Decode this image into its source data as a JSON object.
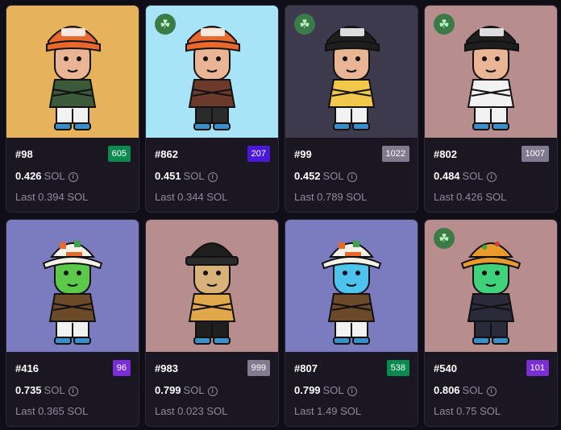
{
  "colors": {
    "rank_green": "#0a8a4e",
    "rank_indigo": "#4a18d9",
    "rank_grey": "#807b8f",
    "rank_purple": "#7a2ed6"
  },
  "cards": [
    {
      "token": "#98",
      "rank": "605",
      "rank_color": "#0a8a4e",
      "price": "0.426",
      "unit": "SOL",
      "last": "Last 0.394 SOL",
      "bg": "#e6b35a",
      "clover": false,
      "hat": "cap-orange",
      "skin": "#e9b594",
      "shirt": "#3a5a3a",
      "pants": "#f2f2f2",
      "hat_text": "PUDGY LAND"
    },
    {
      "token": "#862",
      "rank": "207",
      "rank_color": "#4a18d9",
      "price": "0.451",
      "unit": "SOL",
      "last": "Last 0.344 SOL",
      "bg": "#a7e4f8",
      "clover": true,
      "clover_icon": "☘",
      "hat": "cap-orange",
      "skin": "#e9b594",
      "shirt": "#6b3a2a",
      "pants": "#2a2a2a",
      "hat_text": "PUDGY LAND"
    },
    {
      "token": "#99",
      "rank": "1022",
      "rank_color": "#807b8f",
      "price": "0.452",
      "unit": "SOL",
      "last": "Last 0.789 SOL",
      "bg": "#3c3a4c",
      "clover": true,
      "clover_icon": "☘",
      "hat": "cap-black",
      "skin": "#e9b594",
      "shirt": "#f1c84b",
      "pants": "#f2f2f2",
      "hat_text": "PUDGY LAND"
    },
    {
      "token": "#802",
      "rank": "1007",
      "rank_color": "#807b8f",
      "price": "0.484",
      "unit": "SOL",
      "last": "Last 0.426 SOL",
      "bg": "#b78d8e",
      "clover": true,
      "clover_icon": "☘",
      "hat": "cap-black",
      "skin": "#e9b594",
      "shirt": "#f2f2f2",
      "pants": "#f2f2f2",
      "hat_text": "PUDGY LAND"
    },
    {
      "token": "#416",
      "rank": "96",
      "rank_color": "#7a2ed6",
      "price": "0.735",
      "unit": "SOL",
      "last": "Last 0.365 SOL",
      "bg": "#7b7bbf",
      "clover": false,
      "hat": "bucket-white",
      "skin": "#5dc94a",
      "shirt": "#6b4a2a",
      "pants": "#f2f2f2",
      "hat_text": ""
    },
    {
      "token": "#983",
      "rank": "999",
      "rank_color": "#807b8f",
      "price": "0.799",
      "unit": "SOL",
      "last": "Last 0.023 SOL",
      "bg": "#b78d8e",
      "clover": false,
      "hat": "beanie-black",
      "skin": "#d9b27a",
      "shirt": "#e0a84a",
      "pants": "#1f1f1f",
      "hat_text": ""
    },
    {
      "token": "#807",
      "rank": "538",
      "rank_color": "#0a8a4e",
      "price": "0.799",
      "unit": "SOL",
      "last": "Last 1.49 SOL",
      "bg": "#7b7bbf",
      "clover": false,
      "hat": "bucket-white",
      "skin": "#4cc4ee",
      "shirt": "#6b4a2a",
      "pants": "#f2f2f2",
      "hat_text": ""
    },
    {
      "token": "#540",
      "rank": "101",
      "rank_color": "#7a2ed6",
      "price": "0.806",
      "unit": "SOL",
      "last": "Last 0.75 SOL",
      "bg": "#b78d8e",
      "clover": true,
      "clover_icon": "☘",
      "hat": "bucket-orange",
      "skin": "#3fd27a",
      "shirt": "#2a2a3a",
      "pants": "#2a2a3a",
      "hat_text": ""
    }
  ]
}
